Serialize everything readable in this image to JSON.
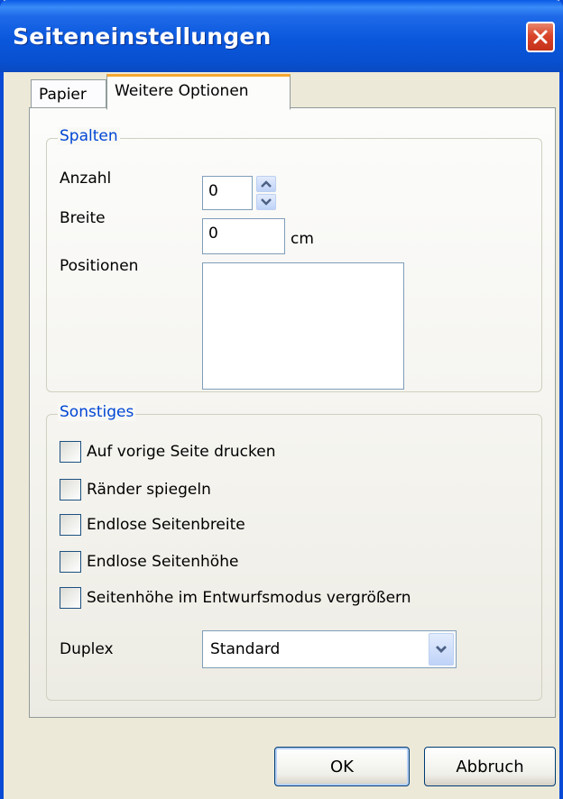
{
  "window": {
    "title": "Seiteneinstellungen"
  },
  "tabs": [
    {
      "label": "Papier",
      "active": false
    },
    {
      "label": "Weitere Optionen",
      "active": true
    }
  ],
  "spalten": {
    "legend": "Spalten",
    "anzahl_label": "Anzahl",
    "anzahl_value": "0",
    "breite_label": "Breite",
    "breite_value": "0",
    "breite_unit": "cm",
    "positionen_label": "Positionen",
    "positionen_value": ""
  },
  "sonstiges": {
    "legend": "Sonstiges",
    "checkboxes": [
      {
        "label": "Auf vorige Seite drucken",
        "checked": false
      },
      {
        "label": "Ränder spiegeln",
        "checked": false
      },
      {
        "label": "Endlose Seitenbreite",
        "checked": false
      },
      {
        "label": "Endlose Seitenhöhe",
        "checked": false
      },
      {
        "label": "Seitenhöhe im Entwurfsmodus vergrößern",
        "checked": false
      }
    ],
    "duplex_label": "Duplex",
    "duplex_value": "Standard"
  },
  "buttons": {
    "ok": "OK",
    "cancel": "Abbruch"
  },
  "icons": {
    "close": "close-icon",
    "spin_up": "chevron-up-icon",
    "spin_down": "chevron-down-icon",
    "dropdown": "chevron-down-icon"
  }
}
